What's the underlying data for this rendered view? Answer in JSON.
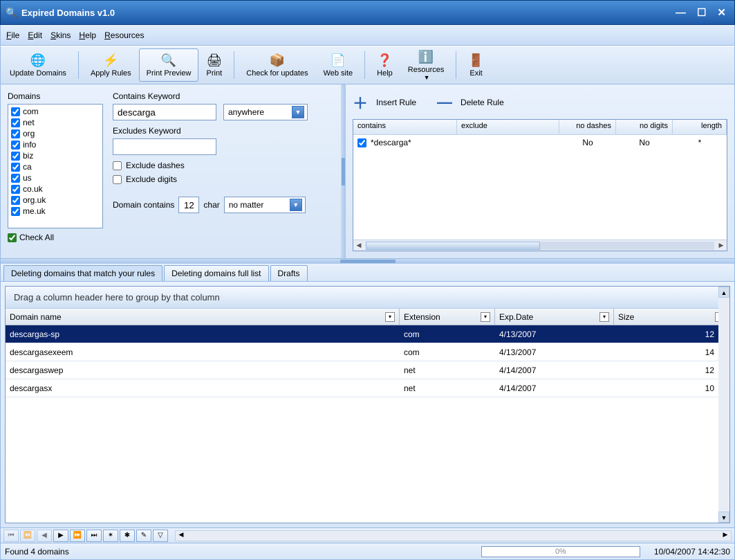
{
  "window": {
    "title": "Expired Domains v1.0"
  },
  "menu": [
    "File",
    "Edit",
    "Skins",
    "Help",
    "Resources"
  ],
  "toolbar": [
    {
      "label": "Update Domains",
      "icon": "🌐"
    },
    {
      "label": "Apply Rules",
      "icon": "⚡"
    },
    {
      "label": "Print Preview",
      "icon": "🔍",
      "active": true
    },
    {
      "label": "Print",
      "icon": "🖨"
    },
    {
      "label": "Check for updates",
      "icon": "📦"
    },
    {
      "label": "Web site",
      "icon": "📄"
    },
    {
      "label": "Help",
      "icon": "❓"
    },
    {
      "label": "Resources",
      "icon": "ℹ️",
      "dropdown": true
    },
    {
      "label": "Exit",
      "icon": "🚪"
    }
  ],
  "domains": {
    "label": "Domains",
    "items": [
      "com",
      "net",
      "org",
      "info",
      "biz",
      "ca",
      "us",
      "co.uk",
      "org.uk",
      "me.uk"
    ],
    "check_all": "Check All"
  },
  "filter": {
    "contains_label": "Contains Keyword",
    "contains_value": "descarga",
    "contains_pos": "anywhere",
    "excludes_label": "Excludes Keyword",
    "excludes_value": "",
    "exclude_dashes": "Exclude dashes",
    "exclude_digits": "Exclude digits",
    "domain_contains_label": "Domain contains",
    "domain_contains_value": "12",
    "char_label": "char",
    "char_mode": "no matter"
  },
  "rules": {
    "insert": "Insert Rule",
    "delete": "Delete Rule",
    "cols": [
      "contains",
      "exclude",
      "no dashes",
      "no digits",
      "length"
    ],
    "rows": [
      {
        "contains": "*descarga*",
        "exclude": "",
        "no_dashes": "No",
        "no_digits": "No",
        "length": "*"
      }
    ]
  },
  "tabs": [
    "Deleting domains that match your rules",
    "Deleting domains full list",
    "Drafts"
  ],
  "grid": {
    "group_hint": "Drag a column header here to group by that column",
    "cols": [
      "Domain name",
      "Extension",
      "Exp.Date",
      "Size"
    ],
    "rows": [
      {
        "name": "descargas-sp",
        "ext": "com",
        "date": "4/13/2007",
        "size": "12",
        "sel": true
      },
      {
        "name": "descargasexeem",
        "ext": "com",
        "date": "4/13/2007",
        "size": "14"
      },
      {
        "name": "descargaswep",
        "ext": "net",
        "date": "4/14/2007",
        "size": "12"
      },
      {
        "name": "descargasx",
        "ext": "net",
        "date": "4/14/2007",
        "size": "10"
      }
    ]
  },
  "status": {
    "text": "Found 4 domains",
    "progress": "0%",
    "time": "10/04/2007 14:42:30"
  }
}
